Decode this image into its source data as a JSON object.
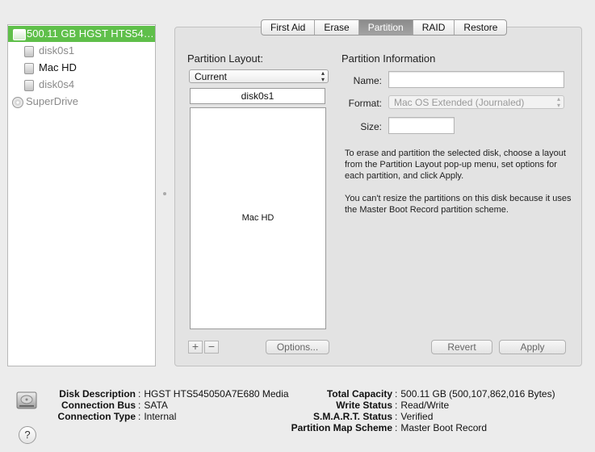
{
  "sidebar": {
    "items": [
      {
        "label": "500.11 GB HGST HTS54…",
        "icon": "hard-disk-icon",
        "selected": true
      },
      {
        "label": "disk0s1",
        "icon": "volume-icon",
        "dimmed": true
      },
      {
        "label": "Mac HD",
        "icon": "volume-icon",
        "dimmed": false
      },
      {
        "label": "disk0s4",
        "icon": "volume-icon",
        "dimmed": true
      },
      {
        "label": "SuperDrive",
        "icon": "optical-drive-icon",
        "dimmed": true
      }
    ]
  },
  "tabs": [
    {
      "label": "First Aid",
      "active": false
    },
    {
      "label": "Erase",
      "active": false
    },
    {
      "label": "Partition",
      "active": true
    },
    {
      "label": "RAID",
      "active": false
    },
    {
      "label": "Restore",
      "active": false
    }
  ],
  "partition_layout": {
    "title": "Partition Layout:",
    "selected": "Current",
    "header_partition": "disk0s1",
    "map_partition": "Mac HD"
  },
  "partition_info": {
    "title": "Partition Information",
    "name_label": "Name:",
    "name_value": "",
    "format_label": "Format:",
    "format_value": "Mac OS Extended (Journaled)",
    "size_label": "Size:",
    "size_value": "",
    "help_text_1": "To erase and partition the selected disk, choose a layout from the Partition Layout pop-up menu, set options for each partition, and click Apply.",
    "help_text_2": "You can't resize the partitions on this disk because it uses the Master Boot Record partition scheme."
  },
  "buttons": {
    "add": "+",
    "remove": "−",
    "options": "Options...",
    "revert": "Revert",
    "apply": "Apply",
    "help": "?"
  },
  "disk_info": {
    "left": [
      {
        "key": "Disk Description",
        "value": "HGST HTS545050A7E680 Media"
      },
      {
        "key": "Connection Bus",
        "value": "SATA"
      },
      {
        "key": "Connection Type",
        "value": "Internal"
      }
    ],
    "right": [
      {
        "key": "Total Capacity",
        "value": "500.11 GB (500,107,862,016 Bytes)"
      },
      {
        "key": "Write Status",
        "value": "Read/Write"
      },
      {
        "key": "S.M.A.R.T. Status",
        "value": "Verified"
      },
      {
        "key": "Partition Map Scheme",
        "value": "Master Boot Record"
      }
    ]
  },
  "colors": {
    "selection": "#5fbf4a",
    "window_bg": "#ececec",
    "active_tab": "#959595"
  }
}
